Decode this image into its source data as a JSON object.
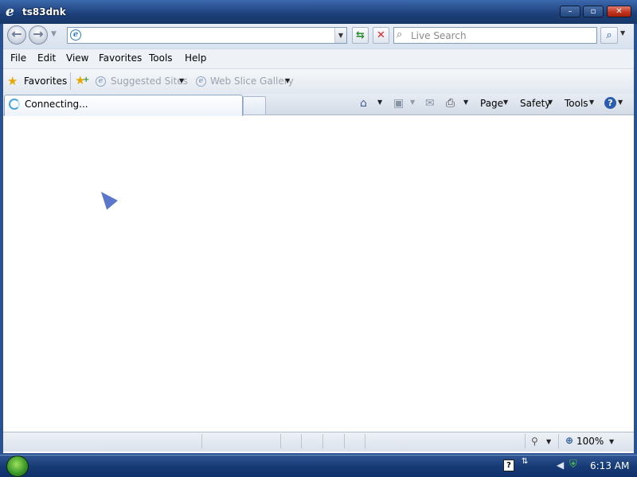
{
  "window": {
    "title": "ts83dnk",
    "minimize_label": "–",
    "maximize_label": "▫",
    "close_label": "✕"
  },
  "address": {
    "value": "",
    "placeholder": ""
  },
  "search": {
    "placeholder": "Live Search"
  },
  "menu": [
    "File",
    "Edit",
    "View",
    "Favorites",
    "Tools",
    "Help"
  ],
  "favorites_bar": {
    "favorites_label": "Favorites",
    "suggested_sites": "Suggested Sites",
    "web_slice_gallery": "Web Slice Gallery"
  },
  "tab": {
    "label": "Connecting..."
  },
  "command_bar": {
    "page": "Page",
    "safety": "Safety",
    "tools": "Tools"
  },
  "status_bar": {
    "zoom": "100%"
  },
  "taskbar": {
    "clock": "6:13 AM"
  },
  "icons": {
    "app": "internet-explorer-icon",
    "back": "back-arrow-icon",
    "forward": "forward-arrow-icon",
    "refresh": "refresh-icon",
    "stop": "stop-icon",
    "search": "magnifier-icon",
    "home": "home-icon",
    "feeds": "rss-feed-icon",
    "mail": "mail-icon",
    "print": "printer-icon",
    "help": "help-icon"
  }
}
